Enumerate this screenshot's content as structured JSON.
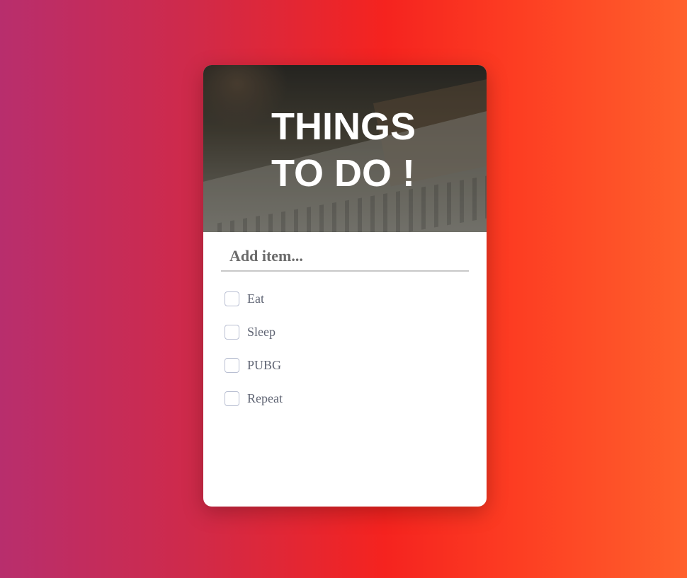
{
  "header": {
    "title": "THINGS\nTO DO !"
  },
  "add_item": {
    "placeholder": "Add item...",
    "value": ""
  },
  "todos": [
    {
      "label": "Eat",
      "checked": false
    },
    {
      "label": "Sleep",
      "checked": false
    },
    {
      "label": "PUBG",
      "checked": false
    },
    {
      "label": "Repeat",
      "checked": false
    }
  ],
  "colors": {
    "gradient_start": "#b82e6d",
    "gradient_mid": "#f5231f",
    "gradient_end": "#ff602c",
    "card_background": "#ffffff",
    "title_text": "#ffffff",
    "item_text": "#5f6473"
  }
}
